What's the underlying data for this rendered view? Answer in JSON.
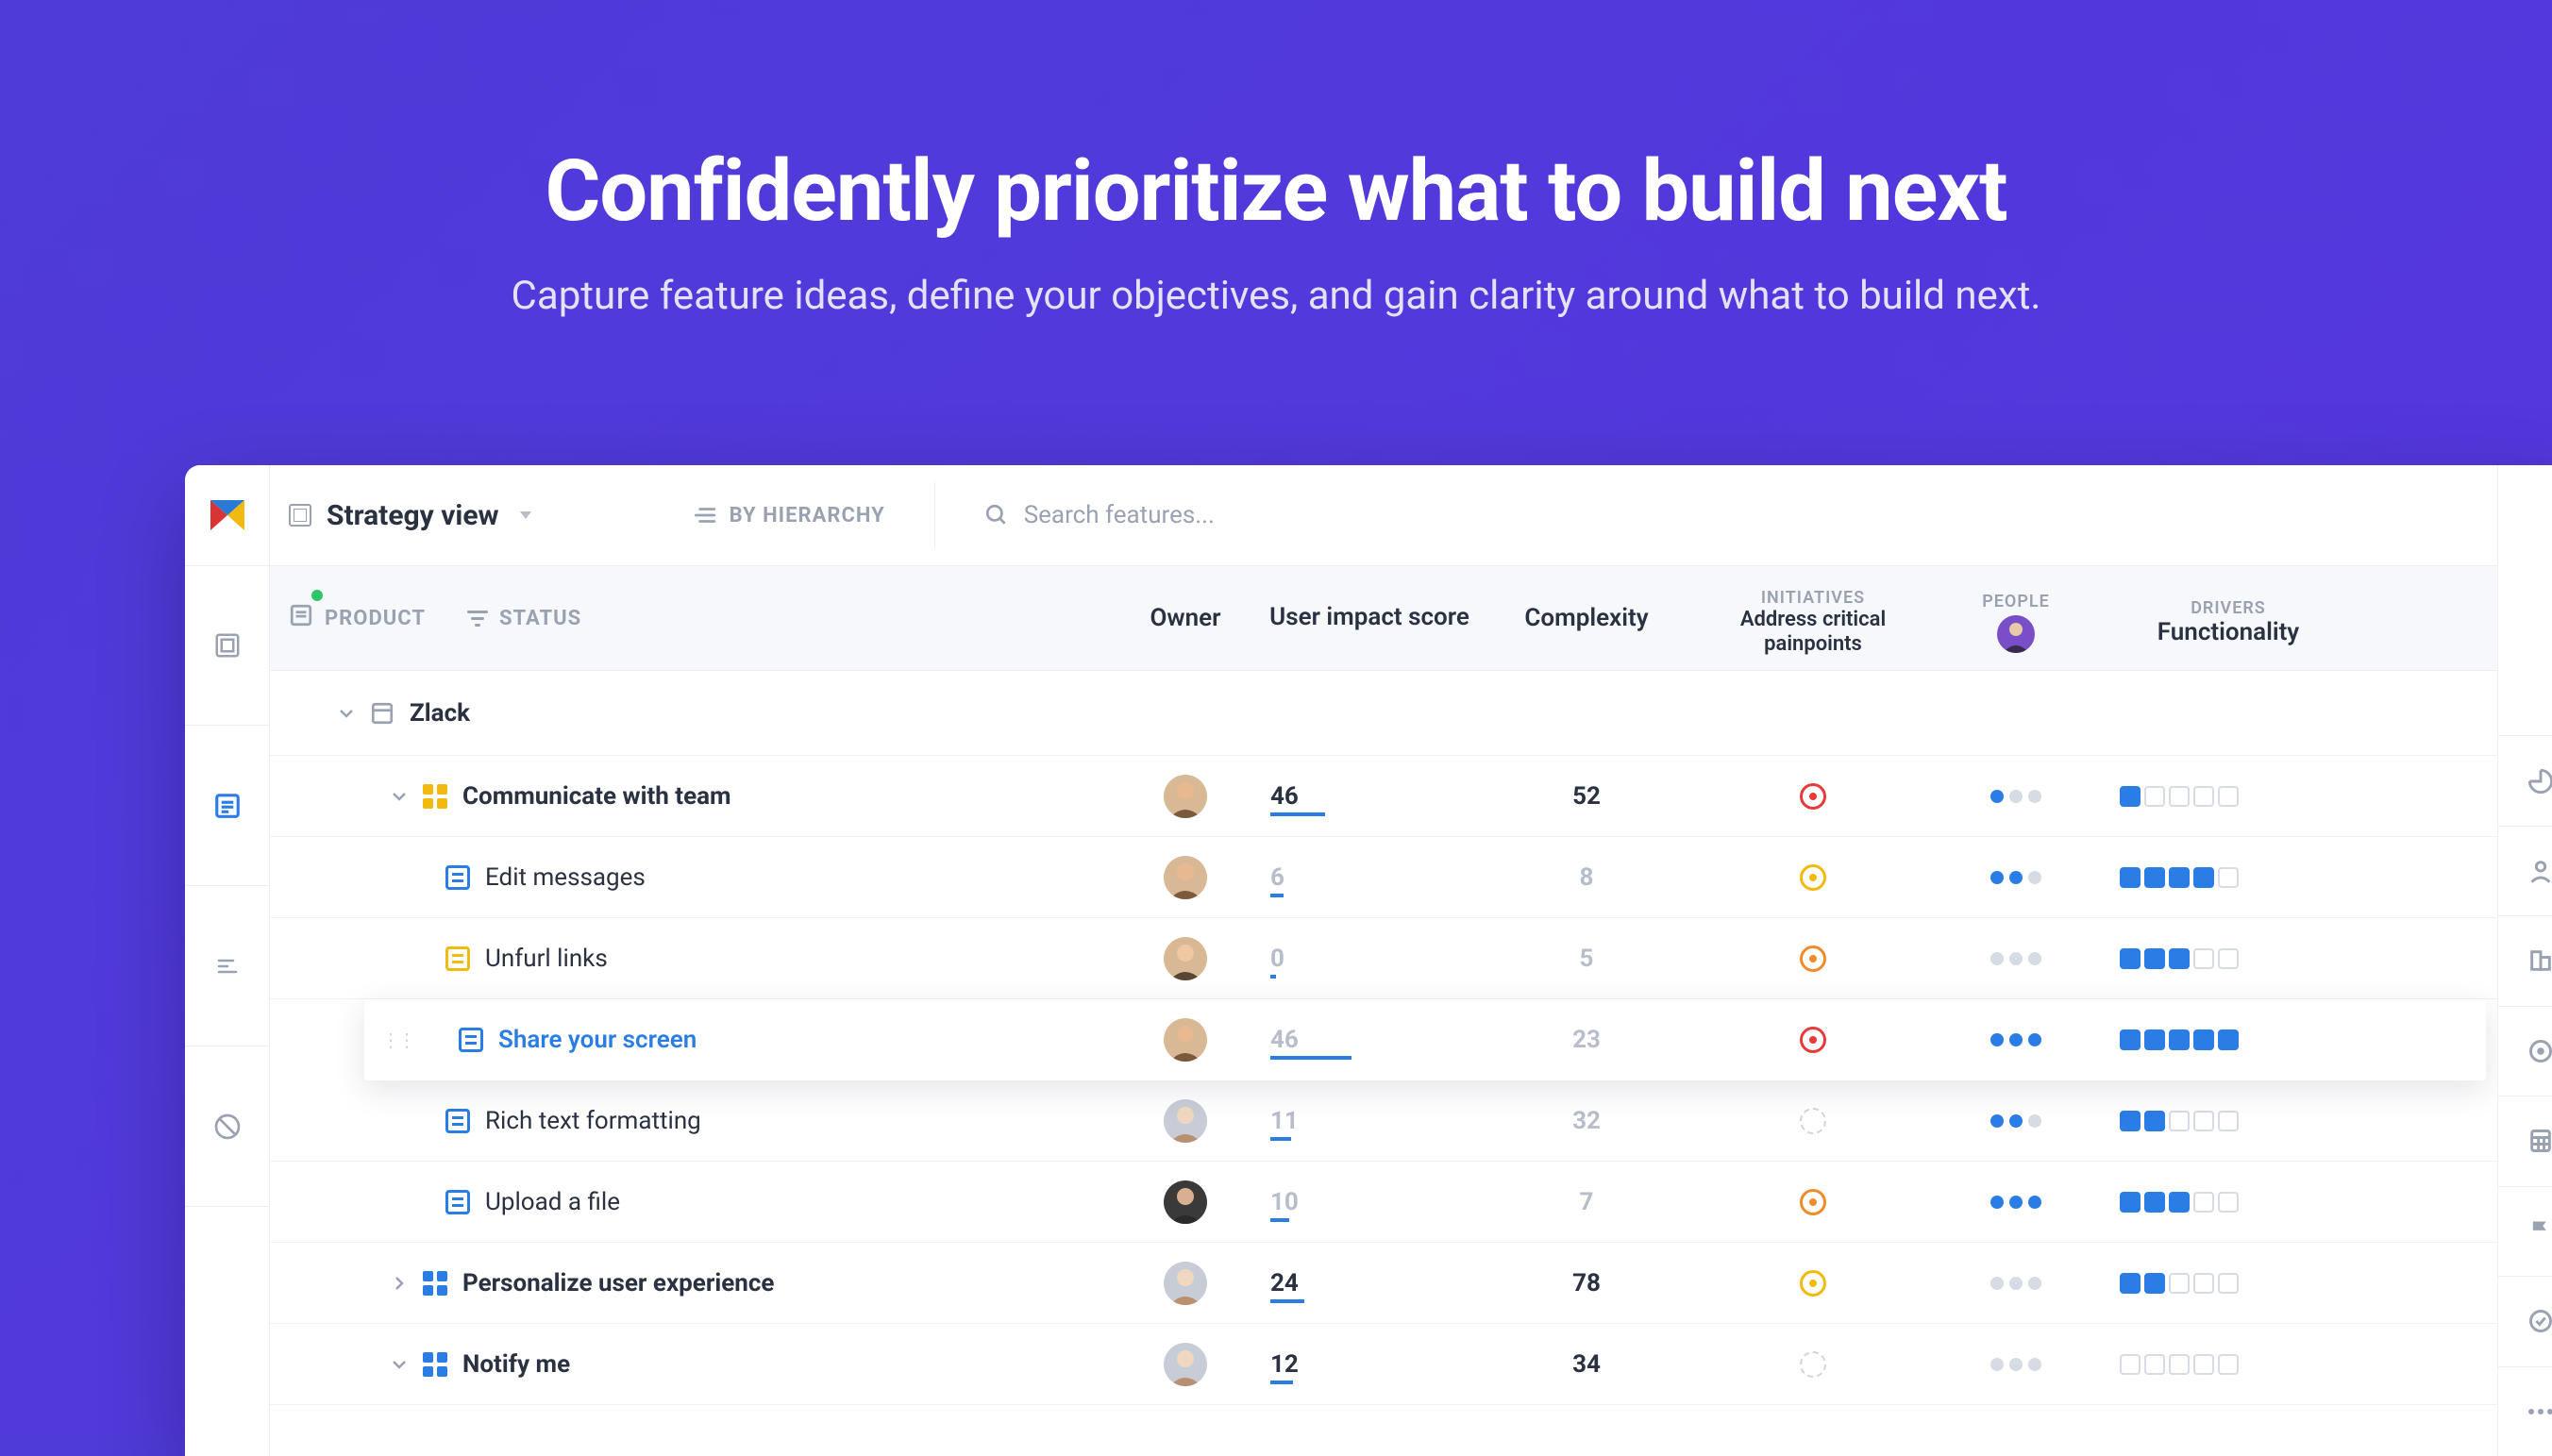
{
  "hero": {
    "title": "Confidently prioritize what to build next",
    "subtitle": "Capture feature ideas, define your objectives, and gain clarity around what to build next."
  },
  "topbar": {
    "view_title": "Strategy view",
    "by_hierarchy": "BY HIERARCHY",
    "search_placeholder": "Search features..."
  },
  "filters": {
    "product": "PRODUCT",
    "status": "STATUS",
    "col_owner": "Owner",
    "col_impact": "User impact score",
    "col_complexity": "Complexity",
    "group_initiatives": "INITIATIVES",
    "col_initiative": "Address critical painpoints",
    "group_people": "PEOPLE",
    "group_drivers": "DRIVERS",
    "col_drivers": "Functionality"
  },
  "product_name": "Zlack",
  "rows": {
    "r1": {
      "name": "Communicate with team",
      "impact": "46",
      "complexity": "52",
      "init": "red",
      "people": 1,
      "drivers": 1
    },
    "r2": {
      "name": "Edit messages",
      "impact": "6",
      "complexity": "8",
      "init": "yellow",
      "people": 2,
      "drivers": 4
    },
    "r3": {
      "name": "Unfurl links",
      "impact": "0",
      "complexity": "5",
      "init": "orange",
      "people": 0,
      "drivers": 3
    },
    "r4": {
      "name": "Share your screen",
      "impact": "46",
      "complexity": "23",
      "init": "red",
      "people": 3,
      "drivers": 5
    },
    "r5": {
      "name": "Rich text formatting",
      "impact": "11",
      "complexity": "32",
      "init": "dashed",
      "people": 2,
      "drivers": 2
    },
    "r6": {
      "name": "Upload a file",
      "impact": "10",
      "complexity": "7",
      "init": "orange",
      "people": 3,
      "drivers": 3
    },
    "r7": {
      "name": "Personalize user experience",
      "impact": "24",
      "complexity": "78",
      "init": "yellow",
      "people": 0,
      "drivers": 2
    },
    "r8": {
      "name": "Notify me",
      "impact": "12",
      "complexity": "34",
      "init": "dashed",
      "people": 0,
      "drivers": 0
    }
  }
}
